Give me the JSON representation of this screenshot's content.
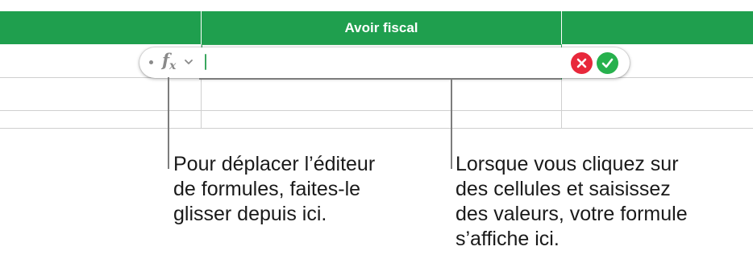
{
  "table": {
    "header_title": "Avoir fiscal"
  },
  "formula_editor": {
    "formula_value": "",
    "fx_icon": "function-fx-icon",
    "drag_handle_icon": "drag-handle-dot-icon",
    "cancel_icon": "cancel-x-icon",
    "confirm_icon": "confirm-check-icon",
    "accent_color": "#3aa75f",
    "cancel_color": "#e8283b",
    "confirm_color": "#27b14d",
    "header_color": "#1f9f4e"
  },
  "callouts": {
    "left": [
      "Pour déplacer l’éditeur",
      "de formules, faites-le",
      "glisser depuis ici."
    ],
    "right": [
      "Lorsque vous cliquez sur",
      "des cellules et saisissez",
      "des valeurs, votre formule",
      "s’affiche ici."
    ]
  }
}
